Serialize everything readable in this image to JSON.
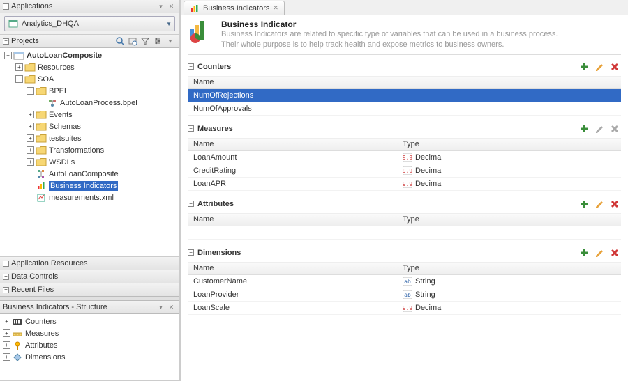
{
  "panels": {
    "applications": {
      "title": "Applications",
      "selected": "Analytics_DHQA"
    },
    "projects": {
      "title": "Projects",
      "tree": [
        {
          "label": "AutoLoanComposite",
          "bold": true,
          "exp": true,
          "type": "project",
          "indent": 0
        },
        {
          "label": "Resources",
          "exp": false,
          "type": "folder",
          "indent": 1
        },
        {
          "label": "SOA",
          "exp": true,
          "type": "folder",
          "indent": 1
        },
        {
          "label": "BPEL",
          "exp": true,
          "type": "folder",
          "indent": 2
        },
        {
          "label": "AutoLoanProcess.bpel",
          "exp": null,
          "type": "bpel",
          "indent": 3
        },
        {
          "label": "Events",
          "exp": false,
          "type": "folder",
          "indent": 2
        },
        {
          "label": "Schemas",
          "exp": false,
          "type": "folder",
          "indent": 2
        },
        {
          "label": "testsuites",
          "exp": false,
          "type": "folder",
          "indent": 2
        },
        {
          "label": "Transformations",
          "exp": false,
          "type": "folder",
          "indent": 2
        },
        {
          "label": "WSDLs",
          "exp": false,
          "type": "folder",
          "indent": 2
        },
        {
          "label": "AutoLoanComposite",
          "exp": null,
          "type": "composite",
          "indent": 2
        },
        {
          "label": "Business Indicators",
          "exp": null,
          "type": "bi",
          "indent": 2,
          "selected": true
        },
        {
          "label": "measurements.xml",
          "exp": null,
          "type": "measure",
          "indent": 2
        }
      ]
    },
    "app_res": "Application Resources",
    "data_ctrl": "Data Controls",
    "recent": "Recent Files"
  },
  "structure": {
    "title": "Business Indicators - Structure",
    "items": [
      {
        "label": "Counters",
        "icon": "counters"
      },
      {
        "label": "Measures",
        "icon": "measures"
      },
      {
        "label": "Attributes",
        "icon": "attributes"
      },
      {
        "label": "Dimensions",
        "icon": "dimensions"
      }
    ]
  },
  "editor": {
    "tab": "Business Indicators",
    "title": "Business  Indicator",
    "desc1": "Business Indicators are related to specific type of variables that can be used in a business process.",
    "desc2": "Their whole purpose is to help track health and expose metrics to business owners.",
    "colName": "Name",
    "colType": "Type",
    "sections": {
      "counters": {
        "title": "Counters",
        "active": true,
        "rows": [
          {
            "name": "NumOfRejections",
            "selected": true
          },
          {
            "name": "NumOfApprovals"
          }
        ]
      },
      "measures": {
        "title": "Measures",
        "active": false,
        "rows": [
          {
            "name": "LoanAmount",
            "type": "Decimal"
          },
          {
            "name": "CreditRating",
            "type": "Decimal"
          },
          {
            "name": "LoanAPR",
            "type": "Decimal"
          }
        ]
      },
      "attributes": {
        "title": "Attributes",
        "active": true,
        "rows": []
      },
      "dimensions": {
        "title": "Dimensions",
        "active": true,
        "rows": [
          {
            "name": "CustomerName",
            "type": "String"
          },
          {
            "name": "LoanProvider",
            "type": "String"
          },
          {
            "name": "LoanScale",
            "type": "Decimal"
          }
        ]
      }
    }
  }
}
